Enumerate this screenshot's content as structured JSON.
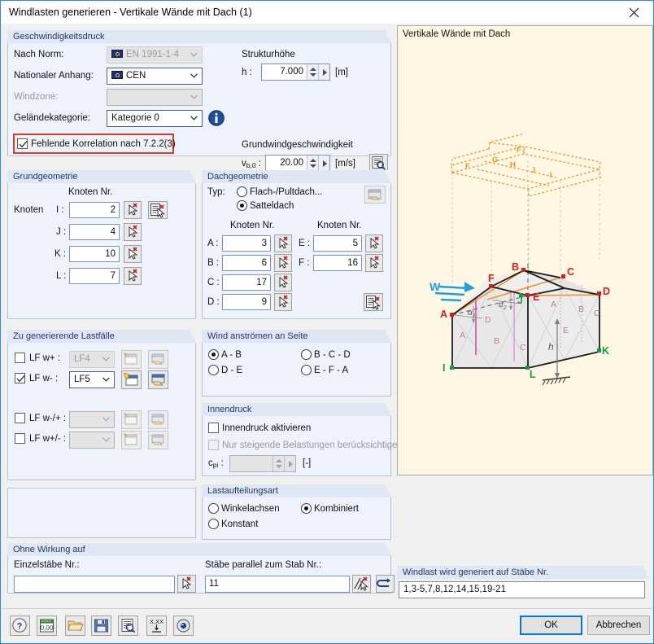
{
  "window": {
    "title": "Windlasten generieren  -  Vertikale Wände mit Dach   (1)",
    "close_icon": "close-icon"
  },
  "velocity_pressure": {
    "legend": "Geschwindigkeitsdruck",
    "standard_label": "Nach Norm:",
    "standard_value": "EN 1991-1-4",
    "annex_label": "Nationaler Anhang:",
    "annex_value": "CEN",
    "windzone_label": "Windzone:",
    "windzone_value": "",
    "terrain_label": "Geländekategorie:",
    "terrain_value": "Kategorie 0",
    "info_icon": "info-icon",
    "correlation_checkbox": "Fehlende Korrelation nach 7.2.2(3)",
    "correlation_checked": true,
    "height_group": "Strukturhöhe",
    "height_label": "h :",
    "height_value": "7.000",
    "height_unit": "[m]",
    "basewind_group": "Grundwindgeschwindigkeit",
    "basewind_label_main": "v",
    "basewind_label_sub": "b,0",
    "basewind_label_colon": " :",
    "basewind_value": "20.00",
    "basewind_unit": "[m/s]",
    "basewind_tool_icon": "table-lookup-icon"
  },
  "base_geometry": {
    "legend": "Grundgeometrie",
    "column_header": "Knoten Nr.",
    "row_caption": "Knoten",
    "pick_icon": "pick-node-icon",
    "list_pick_icon": "pick-from-table-icon",
    "rows": [
      {
        "label": "I :",
        "value": "2"
      },
      {
        "label": "J :",
        "value": "4"
      },
      {
        "label": "K :",
        "value": "10"
      },
      {
        "label": "L :",
        "value": "7"
      }
    ]
  },
  "roof_geometry": {
    "legend": "Dachgeometrie",
    "type_label": "Typ:",
    "type_options": [
      {
        "label": "Flach-/Pultdach...",
        "selected": false
      },
      {
        "label": "Satteldach",
        "selected": true
      }
    ],
    "dialog_icon": "open-dialog-icon",
    "column_header_left": "Knoten Nr.",
    "column_header_right": "Knoten Nr.",
    "pick_icon": "pick-node-icon",
    "list_pick_icon": "pick-from-table-icon",
    "left_rows": [
      {
        "label": "A :",
        "value": "3"
      },
      {
        "label": "B :",
        "value": "6"
      },
      {
        "label": "C :",
        "value": "17"
      },
      {
        "label": "D :",
        "value": "9"
      }
    ],
    "right_rows": [
      {
        "label": "E :",
        "value": "5"
      },
      {
        "label": "F :",
        "value": "16"
      }
    ]
  },
  "load_cases": {
    "legend": "Zu generierende Lastfälle",
    "rows": [
      {
        "label": "LF w+ :",
        "checked": false,
        "value": "LF4",
        "enabled": false
      },
      {
        "label": "LF w- :",
        "checked": true,
        "value": "LF5",
        "enabled": true
      },
      {
        "label": "LF w-/+ :",
        "checked": false,
        "value": "",
        "enabled": false
      },
      {
        "label": "LF w+/- :",
        "checked": false,
        "value": "",
        "enabled": false
      }
    ],
    "new_icon": "new-load-case-icon",
    "edit_icon": "edit-load-case-icon"
  },
  "wind_side": {
    "legend": "Wind anströmen an Seite",
    "options": [
      {
        "label": "A - B",
        "selected": true
      },
      {
        "label": "B - C - D",
        "selected": false
      },
      {
        "label": "D - E",
        "selected": false
      },
      {
        "label": "E - F - A",
        "selected": false
      }
    ]
  },
  "internal_pressure": {
    "legend": "Innendruck",
    "activate_label": "Innendruck aktivieren",
    "activate_checked": false,
    "rising_label": "Nur steigende Belastungen berücksichtigen",
    "rising_checked": false,
    "cpi_label_main": "c",
    "cpi_label_sub": "pi",
    "cpi_label_colon": " :",
    "cpi_value": "",
    "cpi_unit": "[-]"
  },
  "distribution": {
    "legend": "Lastaufteilungsart",
    "options": [
      {
        "label": "Winkelachsen",
        "selected": false
      },
      {
        "label": "Kombiniert",
        "selected": true
      },
      {
        "label": "Konstant",
        "selected": false
      }
    ]
  },
  "without_effect": {
    "legend": "Ohne Wirkung auf",
    "single_label": "Einzelstäbe Nr.:",
    "single_value": "",
    "single_pick_icon": "pick-member-icon",
    "parallel_label": "Stäbe parallel zum Stab Nr.:",
    "parallel_value": "11",
    "parallel_pick_icon": "pick-parallel-members-icon",
    "parallel_select_icon": "select-arrow-icon"
  },
  "result": {
    "legend": "Windlast wird generiert auf Stäbe Nr.",
    "value": "1,3-5,7,8,12,14,15,19-21"
  },
  "preview": {
    "caption": "Vertikale Wände mit Dach",
    "wind_label": "W",
    "height_label": "h",
    "alpha1": "α",
    "alpha1_sub": "1",
    "alpha2": "α",
    "alpha2_sub": "2",
    "node_labels_red": [
      "A",
      "B",
      "C",
      "D",
      "E",
      "F"
    ],
    "node_labels_green": [
      "I",
      "J",
      "K",
      "L"
    ],
    "wall_zones": [
      "A",
      "B",
      "C",
      "D",
      "E"
    ],
    "roof_zones": [
      "F",
      "F",
      "G",
      "H",
      "I",
      "J"
    ],
    "colors": {
      "background": "#fdf7e4",
      "red": "#e01b18",
      "green": "#0f9e3e",
      "orange": "#f08a1c",
      "wind_blue": "#1ba3dd",
      "zone_label": "#b87ba8"
    }
  },
  "toolbar": {
    "buttons": [
      {
        "icon": "help-icon",
        "name": "help-button"
      },
      {
        "icon": "units-icon",
        "name": "units-button"
      },
      {
        "icon": "open-folder-icon",
        "name": "open-button"
      },
      {
        "icon": "save-icon",
        "name": "save-button"
      },
      {
        "icon": "details-icon",
        "name": "details-button"
      },
      {
        "icon": "precision-icon",
        "name": "precision-button"
      },
      {
        "icon": "view-icon",
        "name": "view-button"
      }
    ],
    "ok_label": "OK",
    "cancel_label": "Abbrechen"
  }
}
